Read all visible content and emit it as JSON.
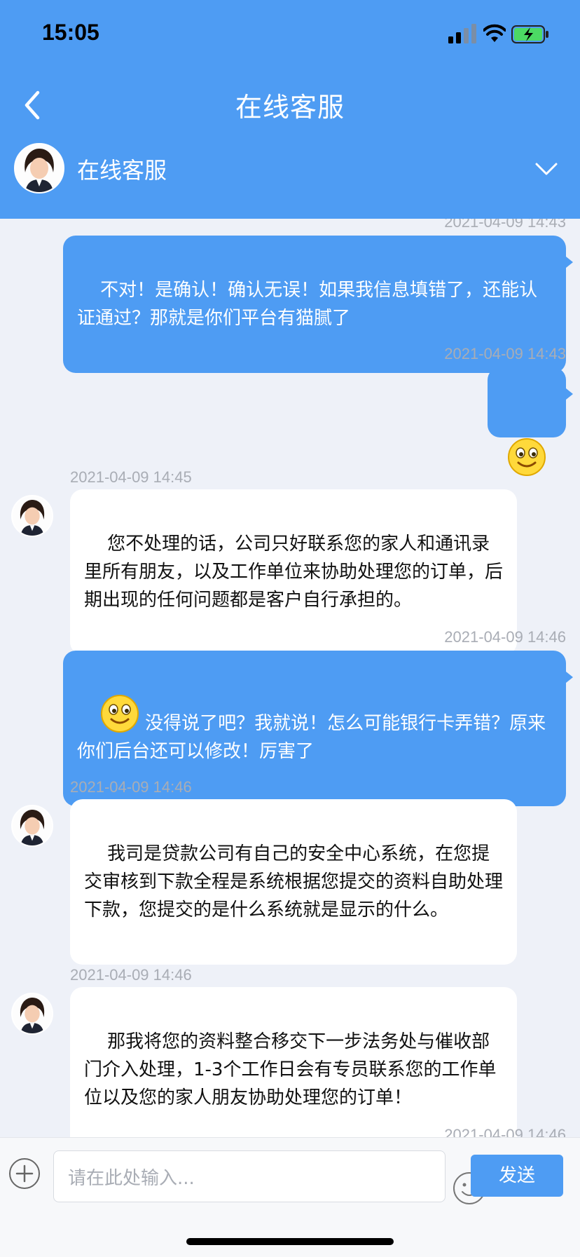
{
  "status_bar": {
    "time": "15:05"
  },
  "header": {
    "title": "在线客服",
    "agent_name": "在线客服"
  },
  "messages": [
    {
      "side": "right",
      "time": "2021-04-09 14:43",
      "text": "不对！是确认！确认无误！如果我信息填错了，还能认证通过？那就是你们平台有猫腻了"
    },
    {
      "side": "right",
      "time": "2021-04-09 14:43",
      "emoji": "smile-emoji"
    },
    {
      "side": "left",
      "time": "2021-04-09 14:45",
      "text": "您不处理的话，公司只好联系您的家人和通讯录里所有朋友，以及工作单位来协助处理您的订单，后期出现的任何问题都是客户自行承担的。"
    },
    {
      "side": "right",
      "time": "2021-04-09 14:46",
      "emoji": "smile-emoji",
      "text": "没得说了吧？我就说！怎么可能银行卡弄错？原来你们后台还可以修改！厉害了"
    },
    {
      "side": "left",
      "time": "2021-04-09 14:46",
      "text": "我司是贷款公司有自己的安全中心系统，在您提交审核到下款全程是系统根据您提交的资料自助处理下款，您提交的是什么系统就是显示的什么。"
    },
    {
      "side": "left",
      "time": "2021-04-09 14:46",
      "text": "那我将您的资料整合移交下一步法务处与催收部门介入处理，1-3个工作日会有专员联系您的工作单位以及您的家人朋友协助处理您的订单！"
    },
    {
      "side": "right",
      "time": "2021-04-09 14:46"
    }
  ],
  "input": {
    "placeholder": "请在此处输入...",
    "send_label": "发送"
  },
  "colors": {
    "brand_blue": "#4e9cf3",
    "background": "#eef1f8",
    "timestamp": "#a9adb5"
  }
}
